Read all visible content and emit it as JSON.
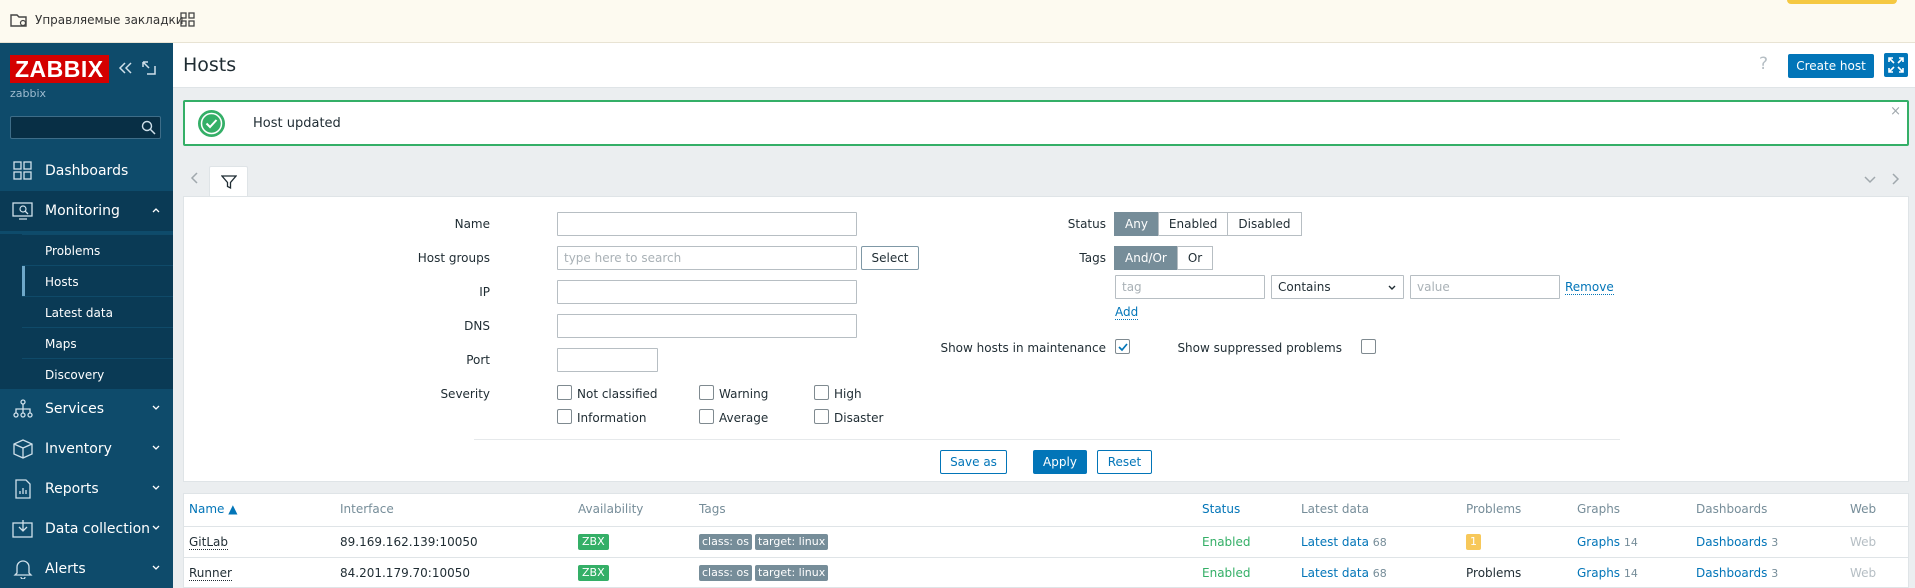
{
  "bookmarks": {
    "managed_label": "Управляемые закладки"
  },
  "sidebar": {
    "logo": "ZABBIX",
    "server_name": "zabbix",
    "search_placeholder": "",
    "menu": [
      {
        "label": "Dashboards",
        "icon": "dashboards-icon"
      },
      {
        "label": "Monitoring",
        "icon": "monitoring-icon"
      },
      {
        "label": "Services",
        "icon": "services-icon"
      },
      {
        "label": "Inventory",
        "icon": "inventory-icon"
      },
      {
        "label": "Reports",
        "icon": "reports-icon"
      },
      {
        "label": "Data collection",
        "icon": "data-collection-icon"
      },
      {
        "label": "Alerts",
        "icon": "alerts-icon"
      }
    ],
    "monitoring_sub": [
      "Problems",
      "Hosts",
      "Latest data",
      "Maps",
      "Discovery"
    ]
  },
  "header": {
    "title": "Hosts",
    "help": "?",
    "create_label": "Create host"
  },
  "message": {
    "text": "Host updated",
    "close": "×"
  },
  "filter": {
    "name_label": "Name",
    "name_value": "",
    "host_groups_label": "Host groups",
    "host_groups_placeholder": "type here to search",
    "select_label": "Select",
    "ip_label": "IP",
    "dns_label": "DNS",
    "port_label": "Port",
    "severity_label": "Severity",
    "severities": [
      "Not classified",
      "Warning",
      "High",
      "Information",
      "Average",
      "Disaster"
    ],
    "status_label": "Status",
    "status_options": [
      "Any",
      "Enabled",
      "Disabled"
    ],
    "status_selected": "Any",
    "tags_label": "Tags",
    "tags_options": [
      "And/Or",
      "Or"
    ],
    "tags_selected": "And/Or",
    "tag_placeholder": "tag",
    "operator_value": "Contains",
    "value_placeholder": "value",
    "remove_label": "Remove",
    "add_label": "Add",
    "maintenance_label": "Show hosts in maintenance",
    "maintenance_checked": true,
    "suppressed_label": "Show suppressed problems",
    "suppressed_checked": false,
    "save_as_label": "Save as",
    "apply_label": "Apply",
    "reset_label": "Reset"
  },
  "table": {
    "headers": [
      "Name ▲",
      "Interface",
      "Availability",
      "Tags",
      "Status",
      "Latest data",
      "Problems",
      "Graphs",
      "Dashboards",
      "Web"
    ],
    "rows": [
      {
        "name": "GitLab",
        "interface": "89.169.162.139:10050",
        "availability": "ZBX",
        "tags": [
          "class: os",
          "target: linux"
        ],
        "status": "Enabled",
        "latest_label": "Latest data",
        "latest_count": "68",
        "problems": "1",
        "graphs_label": "Graphs",
        "graphs_count": "14",
        "dashboards_label": "Dashboards",
        "dashboards_count": "3",
        "web": "Web"
      },
      {
        "name": "Runner",
        "interface": "84.201.179.70:10050",
        "availability": "ZBX",
        "tags": [
          "class: os",
          "target: linux"
        ],
        "status": "Enabled",
        "latest_label": "Latest data",
        "latest_count": "68",
        "problems": "Problems",
        "graphs_label": "Graphs",
        "graphs_count": "14",
        "dashboards_label": "Dashboards",
        "dashboards_count": "3",
        "web": "Web"
      }
    ]
  },
  "colors": {
    "sidebar_bg": "#0e4b6b",
    "accent": "#0275b8",
    "success": "#34af67",
    "logo_red": "#d40000",
    "tag_gray": "#768d99",
    "problem_yellow": "#f7c85a"
  }
}
